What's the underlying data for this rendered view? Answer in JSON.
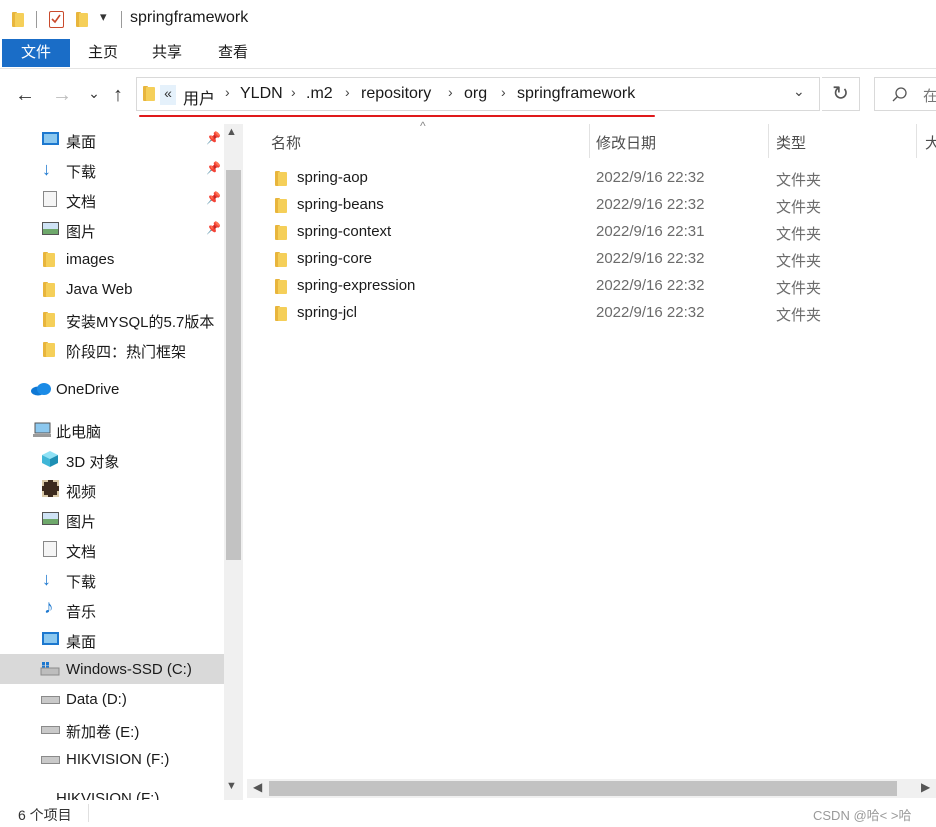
{
  "window": {
    "title": "springframework"
  },
  "ribbon": {
    "tabs": [
      {
        "label": "文件"
      },
      {
        "label": "主页"
      },
      {
        "label": "共享"
      },
      {
        "label": "查看"
      }
    ]
  },
  "nav": {
    "back": "←",
    "forward": "→",
    "recent": "⌄",
    "up": "↑",
    "refresh": "↻"
  },
  "address": {
    "overflow": "«",
    "crumbs": [
      "用户",
      "YLDN",
      ".m2",
      "repository",
      "org",
      "springframework"
    ],
    "separator": "›",
    "dropdown": "⌄"
  },
  "search": {
    "placeholder": "在"
  },
  "sidebar": {
    "quick_access": [
      {
        "label": "桌面",
        "icon": "desktop-icon",
        "pinned": true
      },
      {
        "label": "下载",
        "icon": "download-icon",
        "pinned": true
      },
      {
        "label": "文档",
        "icon": "document-icon",
        "pinned": true
      },
      {
        "label": "图片",
        "icon": "pictures-icon",
        "pinned": true
      },
      {
        "label": "images",
        "icon": "folder-icon"
      },
      {
        "label": "Java Web",
        "icon": "folder-icon"
      },
      {
        "label": "安装MYSQL的5.7版本",
        "icon": "folder-icon"
      },
      {
        "label": "阶段四：热门框架",
        "icon": "folder-icon"
      }
    ],
    "onedrive": {
      "label": "OneDrive",
      "icon": "cloud-icon"
    },
    "this_pc": {
      "label": "此电脑",
      "icon": "computer-icon"
    },
    "pc_items": [
      {
        "label": "3D 对象",
        "icon": "cube-icon"
      },
      {
        "label": "视频",
        "icon": "film-icon"
      },
      {
        "label": "图片",
        "icon": "pictures-icon"
      },
      {
        "label": "文档",
        "icon": "document-icon"
      },
      {
        "label": "下载",
        "icon": "download-icon"
      },
      {
        "label": "音乐",
        "icon": "music-icon"
      },
      {
        "label": "桌面",
        "icon": "desktop-icon"
      },
      {
        "label": "Windows-SSD (C:)",
        "icon": "windows-drive-icon",
        "selected": true
      },
      {
        "label": "Data (D:)",
        "icon": "drive-icon"
      },
      {
        "label": "新加卷 (E:)",
        "icon": "drive-icon"
      },
      {
        "label": "HIKVISION (F:)",
        "icon": "drive-icon"
      },
      {
        "label": "HIKVISION (F:)",
        "icon": "drive-icon"
      }
    ]
  },
  "list": {
    "columns": {
      "name": "名称",
      "modified": "修改日期",
      "type": "类型",
      "size": "大"
    },
    "rows": [
      {
        "name": "spring-aop",
        "modified": "2022/9/16 22:32",
        "type": "文件夹"
      },
      {
        "name": "spring-beans",
        "modified": "2022/9/16 22:32",
        "type": "文件夹"
      },
      {
        "name": "spring-context",
        "modified": "2022/9/16 22:31",
        "type": "文件夹"
      },
      {
        "name": "spring-core",
        "modified": "2022/9/16 22:32",
        "type": "文件夹"
      },
      {
        "name": "spring-expression",
        "modified": "2022/9/16 22:32",
        "type": "文件夹"
      },
      {
        "name": "spring-jcl",
        "modified": "2022/9/16 22:32",
        "type": "文件夹"
      }
    ]
  },
  "status": {
    "count": "6 个项目"
  },
  "watermark": "CSDN @哈< >哈",
  "colors": {
    "accent": "#1a6dc7",
    "annotation": "#e0191b",
    "folder": "#f5cf59"
  }
}
